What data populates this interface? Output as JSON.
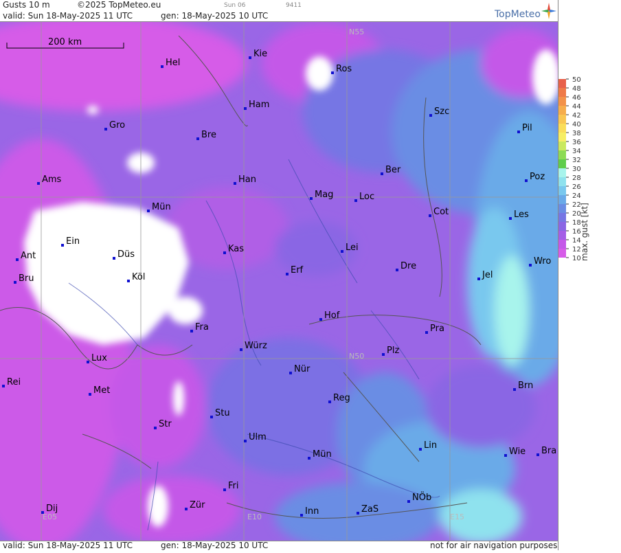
{
  "header": {
    "product": "Gusts 10 m",
    "copyright": "©2025 TopMeteo.eu",
    "day_code": "Sun 06",
    "run_code": "9411",
    "valid": "valid:  Sun  18-May-2025  11 UTC",
    "gen": "gen: 18-May-2025 10 UTC"
  },
  "logo": {
    "text": "TopMeteo",
    "icon": "compass-star-icon"
  },
  "footer": {
    "valid": "valid:  Sun  18-May-2025  11 UTC",
    "gen": "gen: 18-May-2025 10 UTC",
    "disclaimer": "not for air navigation purposes"
  },
  "scale_bar": {
    "label": "200 km"
  },
  "grid_labels": [
    "N55",
    "N50",
    "E05",
    "E10",
    "E15"
  ],
  "cities": [
    "Hel",
    "Kie",
    "Ros",
    "Ham",
    "Gro",
    "Bre",
    "Szc",
    "Pil",
    "Ber",
    "Poz",
    "Ams",
    "Han",
    "Mün",
    "Mag",
    "Loc",
    "Cot",
    "Les",
    "Ein",
    "Kas",
    "Lei",
    "Ant",
    "Düs",
    "Wro",
    "Köl",
    "Dre",
    "Jel",
    "Bru",
    "Erf",
    "Hof",
    "Fra",
    "Pra",
    "Würz",
    "Plz",
    "Lux",
    "Nür",
    "Rei",
    "Met",
    "Brn",
    "Reg",
    "Stu",
    "Str",
    "Lin",
    "Ulm",
    "Wie",
    "Bra",
    "Mün",
    "Fri",
    "NÖb",
    "Dij",
    "Zür",
    "Inn",
    "ZaS"
  ],
  "legend": {
    "title": "max. gust  [kt]",
    "ticks": [
      "50",
      "48",
      "46",
      "44",
      "42",
      "40",
      "38",
      "36",
      "34",
      "32",
      "30",
      "28",
      "26",
      "24",
      "22",
      "20",
      "18",
      "16",
      "14",
      "12",
      "10"
    ],
    "colors": [
      "#e8604a",
      "#ef7a48",
      "#f3924a",
      "#f6ad4d",
      "#f9c653",
      "#fadd5a",
      "#f6ee64",
      "#c9e95f",
      "#8ddb55",
      "#5fcd4c",
      "#a8f4ec",
      "#8fe2ee",
      "#79c8ee",
      "#6aaae8",
      "#6a8de4",
      "#7676e4",
      "#8a66e4",
      "#a45ee6",
      "#c458e8",
      "#d65ce8"
    ]
  }
}
